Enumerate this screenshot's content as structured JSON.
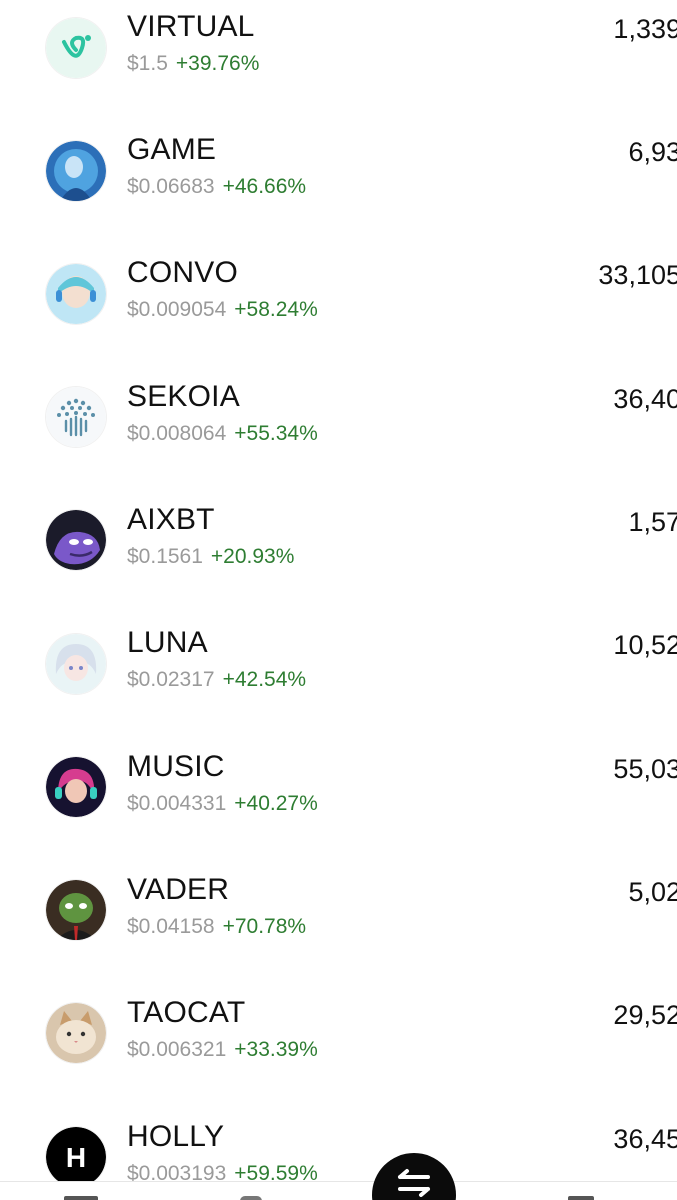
{
  "tokens": [
    {
      "symbol": "VIRTUAL",
      "price": "$1.5",
      "change": "+39.76%",
      "amount": "1,339",
      "icon": "virtual-logo"
    },
    {
      "symbol": "GAME",
      "price": "$0.06683",
      "change": "+46.66%",
      "amount": "6,93",
      "icon": "game-avatar"
    },
    {
      "symbol": "CONVO",
      "price": "$0.009054",
      "change": "+58.24%",
      "amount": "33,105",
      "icon": "convo-avatar"
    },
    {
      "symbol": "SEKOIA",
      "price": "$0.008064",
      "change": "+55.34%",
      "amount": "36,40",
      "icon": "sekoia-tree-logo"
    },
    {
      "symbol": "AIXBT",
      "price": "$0.1561",
      "change": "+20.93%",
      "amount": "1,57",
      "icon": "aixbt-avatar"
    },
    {
      "symbol": "LUNA",
      "price": "$0.02317",
      "change": "+42.54%",
      "amount": "10,52",
      "icon": "luna-avatar"
    },
    {
      "symbol": "MUSIC",
      "price": "$0.004331",
      "change": "+40.27%",
      "amount": "55,03",
      "icon": "music-avatar"
    },
    {
      "symbol": "VADER",
      "price": "$0.04158",
      "change": "+70.78%",
      "amount": "5,02",
      "icon": "vader-avatar"
    },
    {
      "symbol": "TAOCAT",
      "price": "$0.006321",
      "change": "+33.39%",
      "amount": "29,52",
      "icon": "taocat-avatar"
    },
    {
      "symbol": "HOLLY",
      "price": "$0.003193",
      "change": "+59.59%",
      "amount": "36,45",
      "icon": "holly-letter-logo",
      "icon_letter": "H"
    }
  ],
  "colors": {
    "positive_change": "#2e7d32",
    "price_text": "#9a9a9a",
    "primary_text": "#111111",
    "fab_background": "#0b0b0b"
  },
  "fab": {
    "icon": "swap-arrows-icon"
  }
}
